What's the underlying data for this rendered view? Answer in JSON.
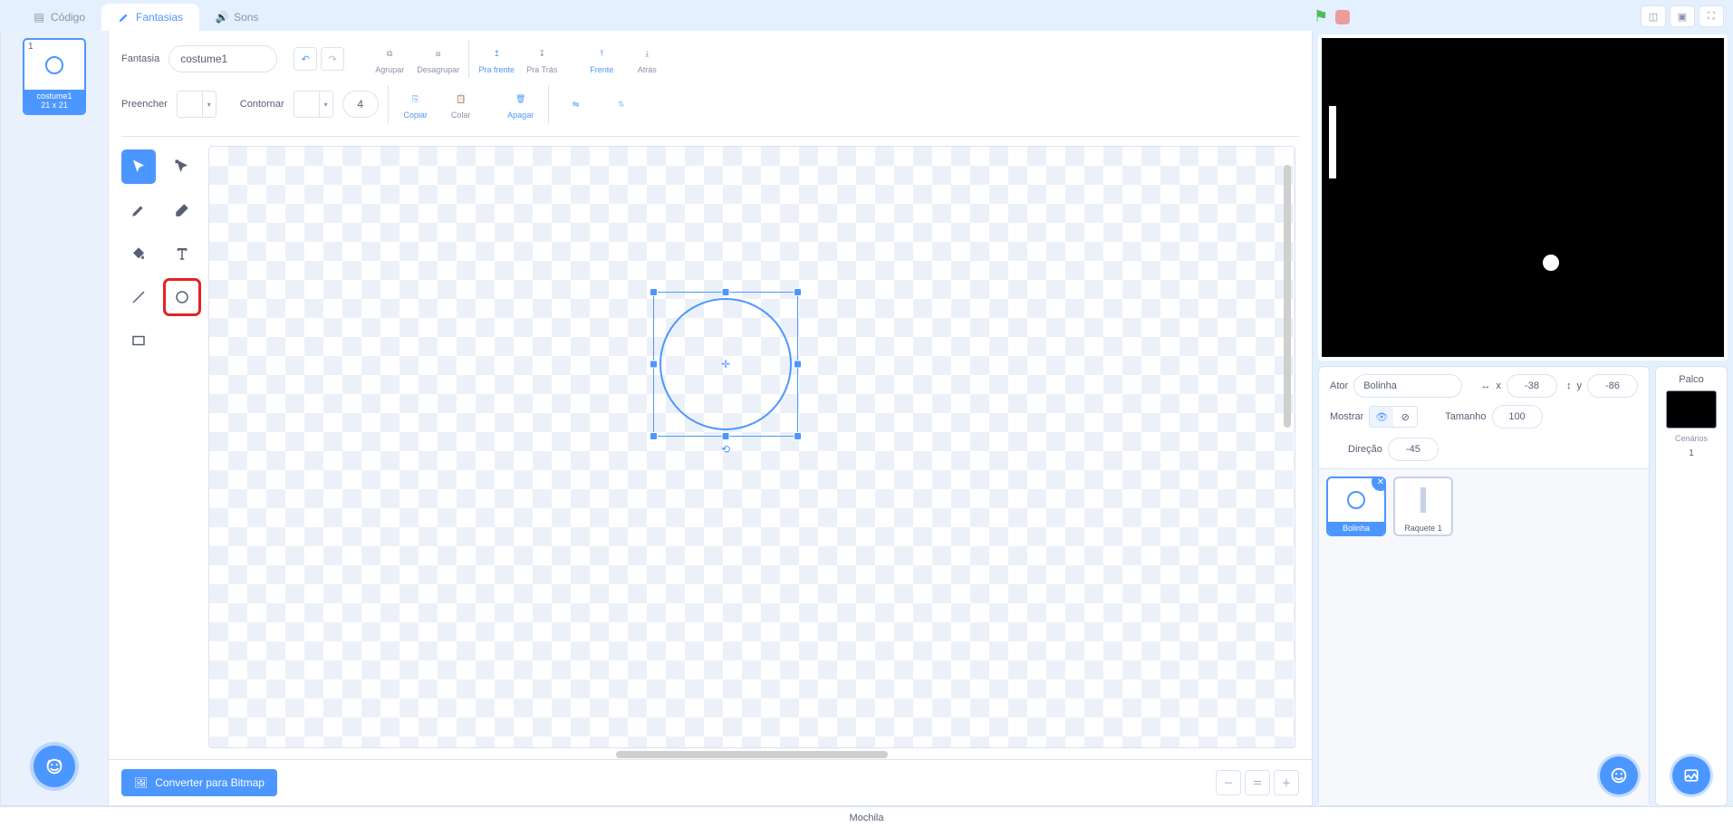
{
  "tabs": {
    "code": "Código",
    "costumes": "Fantasias",
    "sounds": "Sons"
  },
  "costume_list": {
    "selected": {
      "index": "1",
      "name": "costume1",
      "size": "21 x 21"
    }
  },
  "toolbar": {
    "costume_label": "Fantasia",
    "costume_name": "costume1",
    "group": "Agrupar",
    "ungroup": "Desagrupar",
    "forward": "Pra frente",
    "backward": "Pra Trás",
    "front": "Frente",
    "back": "Atrás",
    "fill_label": "Preencher",
    "outline_label": "Contornar",
    "outline_width": "4",
    "copy": "Copiar",
    "paste": "Colar",
    "delete": "Apagar"
  },
  "convert_button": "Converter para Bitmap",
  "sprite_panel": {
    "sprite_label": "Ator",
    "sprite_name": "Bolinha",
    "x_label": "x",
    "x_value": "-38",
    "y_label": "y",
    "y_value": "-86",
    "show_label": "Mostrar",
    "size_label": "Tamanho",
    "size_value": "100",
    "direction_label": "Direção",
    "direction_value": "-45",
    "sprites": [
      {
        "name": "Bolinha"
      },
      {
        "name": "Raquete 1"
      }
    ]
  },
  "stage_panel": {
    "label": "Palco",
    "backdrops_label": "Cenários",
    "backdrops_count": "1"
  },
  "backpack_label": "Mochila"
}
